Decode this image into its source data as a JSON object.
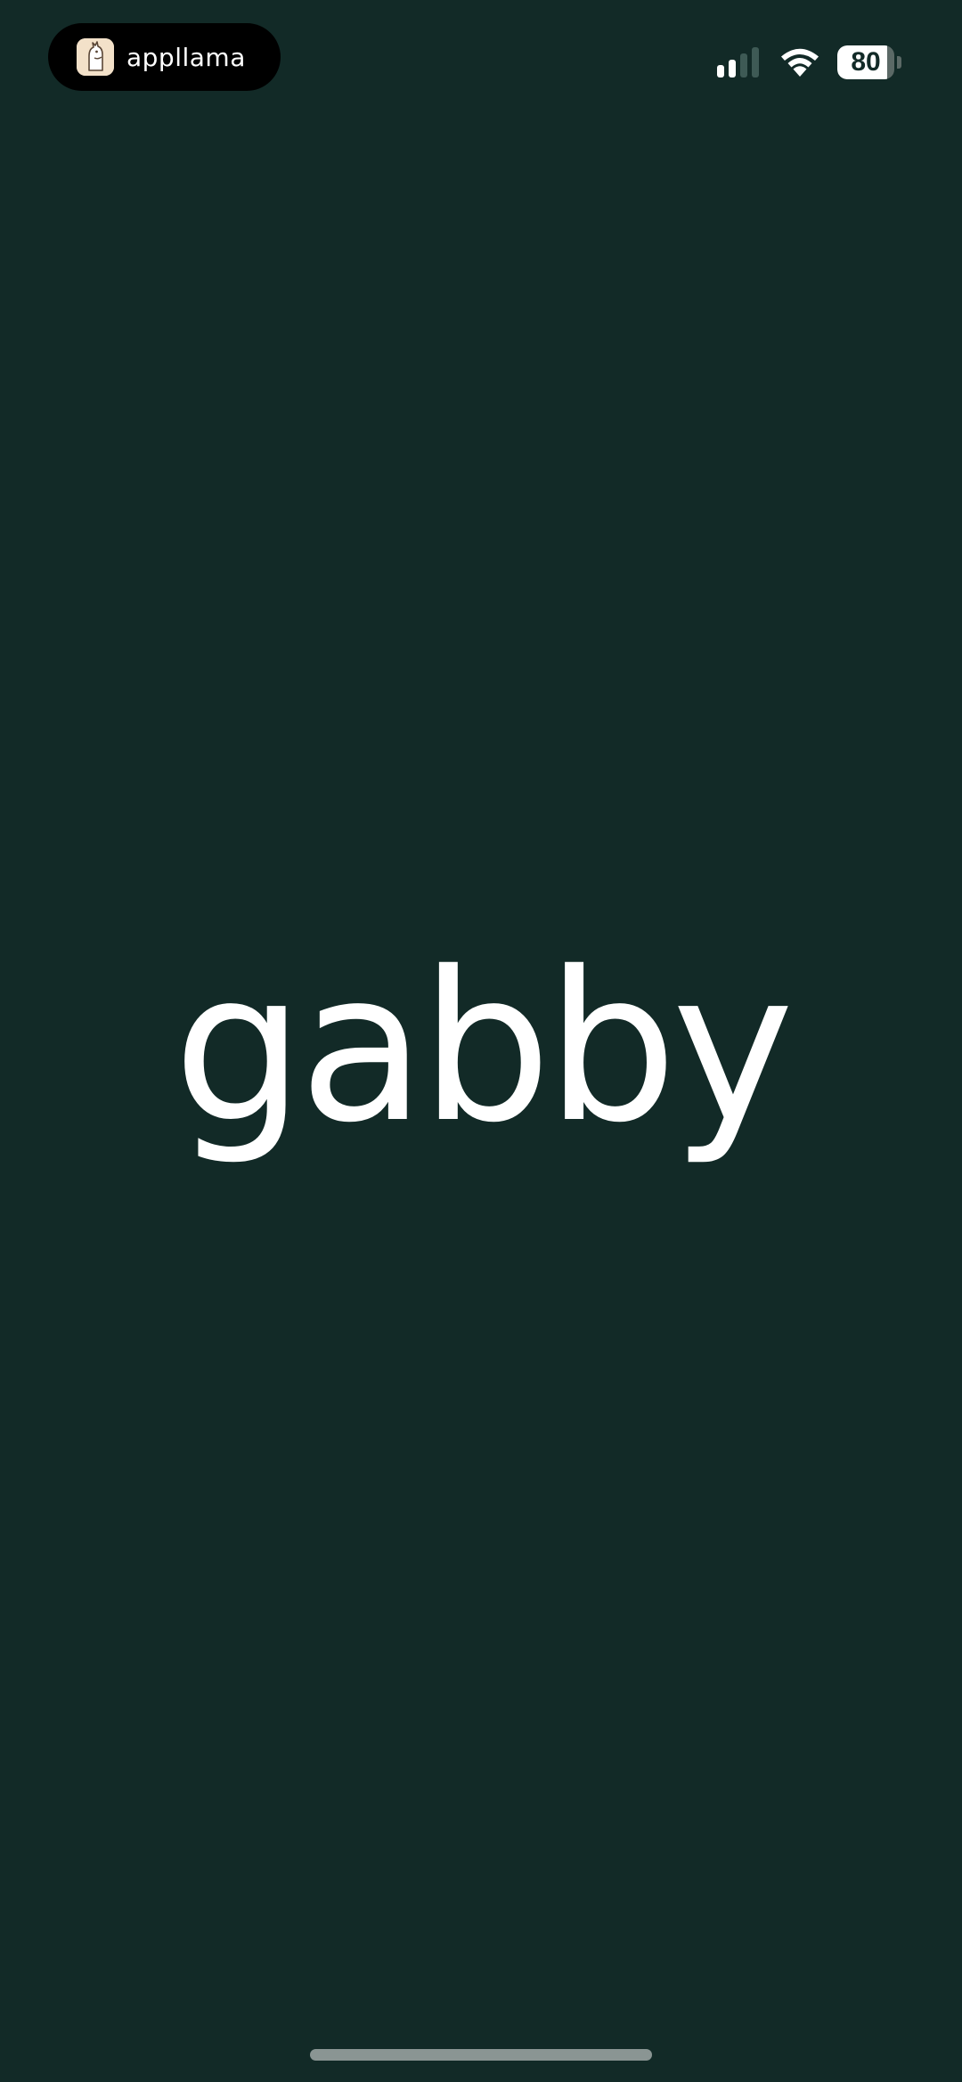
{
  "status_bar": {
    "island": {
      "app_icon": "llama-icon",
      "label": "appllama"
    },
    "signal": {
      "icon": "cellular-signal-icon",
      "bars_total": 4,
      "bars_active": 2
    },
    "wifi": {
      "icon": "wifi-icon"
    },
    "battery": {
      "icon": "battery-icon",
      "level_text": "80",
      "level_percent": 80
    }
  },
  "splash": {
    "logo_text": "gabby"
  },
  "colors": {
    "background": "#122a27",
    "text": "#ffffff",
    "inactive": "#5b6966"
  }
}
